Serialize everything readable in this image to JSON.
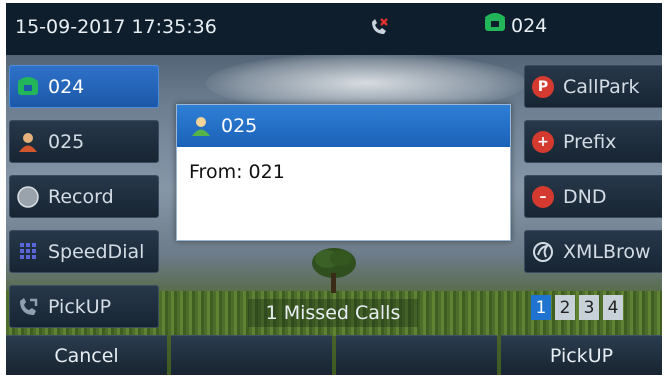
{
  "status_bar": {
    "datetime": "15-09-2017 17:35:36",
    "missed_icon": "missed-call-icon",
    "line_label": "024"
  },
  "line_keys": [
    {
      "label": "024",
      "icon": "phone-icon",
      "active": true
    },
    {
      "label": "025",
      "icon": "contact-icon"
    },
    {
      "label": "Record",
      "icon": "record-icon"
    },
    {
      "label": "SpeedDial",
      "icon": "keypad-icon"
    },
    {
      "label": "PickUP",
      "icon": "pickup-icon"
    }
  ],
  "right_keys": [
    {
      "label": "CallPark",
      "badge": "P",
      "color": "#d43a2f"
    },
    {
      "label": "Prefix",
      "badge": "+",
      "color": "#d43a2f"
    },
    {
      "label": "DND",
      "badge": "–",
      "color": "#d43a2f"
    },
    {
      "label": "XMLBrow",
      "icon": "globe-icon"
    }
  ],
  "popup": {
    "title": "025",
    "message": "From: 021"
  },
  "missed_calls": "1 Missed Calls",
  "pages": [
    "1",
    "2",
    "3",
    "4"
  ],
  "active_page": "1",
  "softkeys": [
    "Cancel",
    "",
    "",
    "PickUP"
  ]
}
